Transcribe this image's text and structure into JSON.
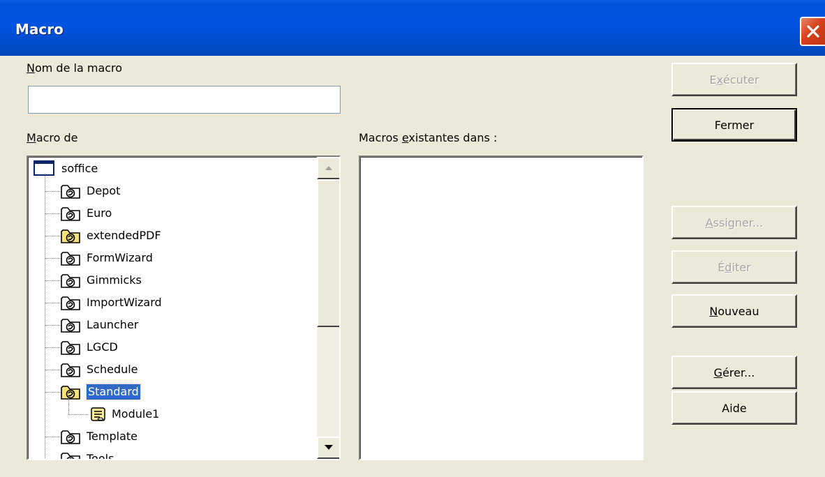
{
  "window": {
    "title": "Macro"
  },
  "labels": {
    "macro_name_pre": "",
    "macro_name_ul": "N",
    "macro_name_post": "om de la macro",
    "macro_from_pre": "",
    "macro_from_ul": "M",
    "macro_from_post": "acro de",
    "existing_pre": "Macros ",
    "existing_ul": "e",
    "existing_post": "xistantes dans :"
  },
  "macro_name_input": {
    "value": ""
  },
  "tree": {
    "root": "soffice",
    "items": [
      {
        "label": "Depot",
        "highlight": false
      },
      {
        "label": "Euro",
        "highlight": false
      },
      {
        "label": "extendedPDF",
        "highlight": true
      },
      {
        "label": "FormWizard",
        "highlight": false
      },
      {
        "label": "Gimmicks",
        "highlight": false
      },
      {
        "label": "ImportWizard",
        "highlight": false
      },
      {
        "label": "Launcher",
        "highlight": false
      },
      {
        "label": "LGCD",
        "highlight": false
      },
      {
        "label": "Schedule",
        "highlight": false
      },
      {
        "label": "Standard",
        "highlight": true,
        "selected": true
      },
      {
        "label": "Module1",
        "module": true
      },
      {
        "label": "Template",
        "highlight": false
      },
      {
        "label": "Tools",
        "highlight": false
      }
    ]
  },
  "buttons": [
    {
      "pre": "E",
      "ul": "x",
      "post": "écuter",
      "disabled": true
    },
    {
      "pre": "Fermer",
      "ul": "",
      "post": "",
      "default": true
    },
    {
      "pre": "",
      "ul": "A",
      "post": "ssigner...",
      "disabled": true
    },
    {
      "pre": "É",
      "ul": "d",
      "post": "iter",
      "disabled": true
    },
    {
      "pre": "",
      "ul": "N",
      "post": "ouveau"
    },
    {
      "pre": "",
      "ul": "G",
      "post": "érer..."
    },
    {
      "pre": "Aide",
      "ul": "",
      "post": ""
    }
  ],
  "colors": {
    "titlebar": "#0054e3",
    "dialog_bg": "#ece9d8",
    "selection": "#316ac5",
    "folder_yellow": "#f5e27a",
    "close_red": "#d6421e"
  }
}
